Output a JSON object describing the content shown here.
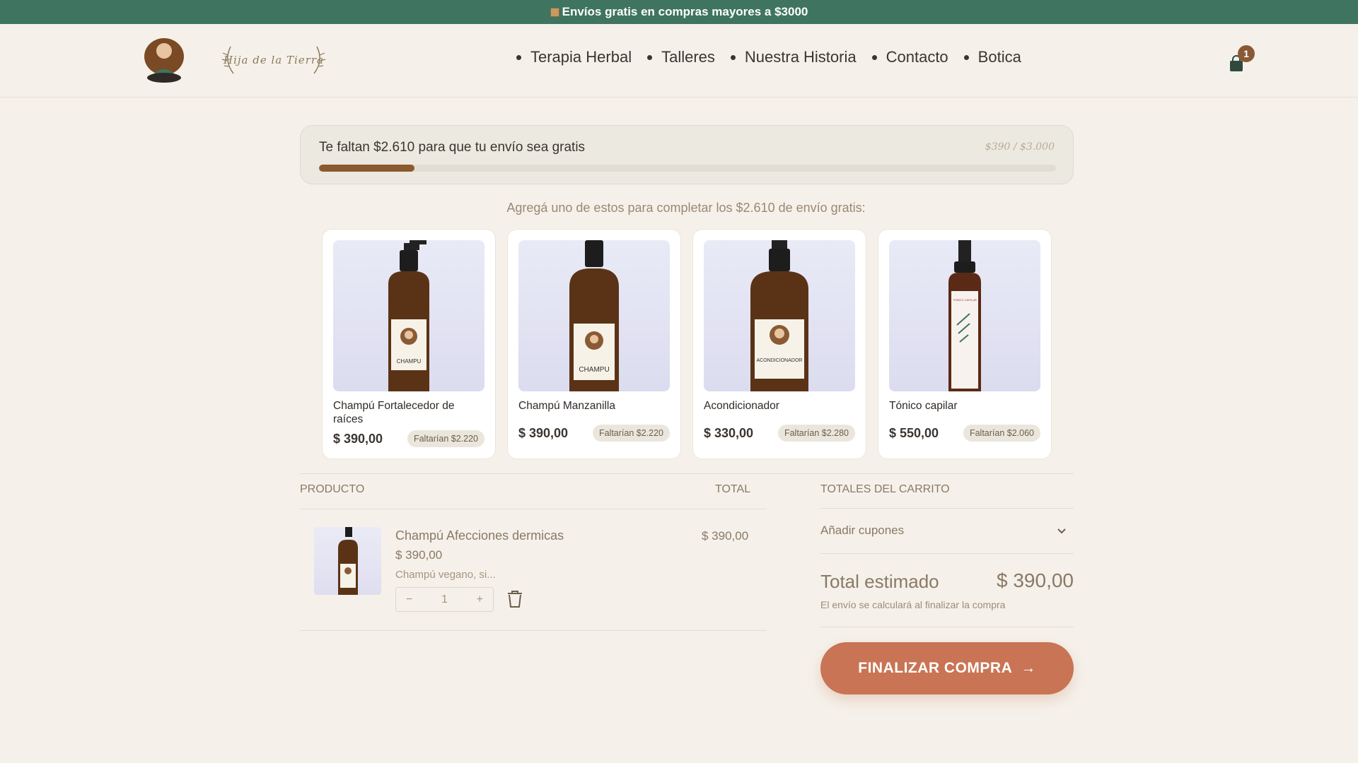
{
  "topbar": {
    "text": "Envíos gratis en compras mayores a $3000",
    "icon": "package-icon"
  },
  "header": {
    "logo_text": "Hija de la Tierra",
    "nav": [
      "Terapia Herbal",
      "Talleres",
      "Nuestra Historia",
      "Contacto",
      "Botica"
    ],
    "cart_count": "1"
  },
  "shipping_progress": {
    "message": "Te faltan $2.610 para que tu envío sea gratis",
    "ratio_label": "$390 / $3.000",
    "fraction": 0.13
  },
  "suggestions": {
    "title": "Agregá uno de estos para completar los $2.610 de envío gratis:",
    "items": [
      {
        "name": "Champú Fortalecedor de raíces",
        "price": "$ 390,00",
        "need": "Faltarían $2.220",
        "label": "CHAMPU"
      },
      {
        "name": "Champú Manzanilla",
        "price": "$ 390,00",
        "need": "Faltarían $2.220",
        "label": "CHAMPU"
      },
      {
        "name": "Acondicionador",
        "price": "$ 330,00",
        "need": "Faltarían $2.280",
        "label": "ACONDICIONADOR"
      },
      {
        "name": "Tónico capilar",
        "price": "$ 550,00",
        "need": "Faltarían $2.060",
        "label": "TÓNICO CAPILAR"
      }
    ]
  },
  "cart": {
    "col_product": "PRODUCTO",
    "col_total": "TOTAL",
    "item": {
      "name": "Champú Afecciones dermicas",
      "price": "$ 390,00",
      "desc": "Champú vegano, si...",
      "qty": "1",
      "minus": "−",
      "plus": "+",
      "total": "$ 390,00"
    }
  },
  "totals": {
    "heading": "TOTALES DEL CARRITO",
    "coupon_label": "Añadir cupones",
    "estimated_label": "Total estimado",
    "estimated_value": "$ 390,00",
    "note": "El envío se calculará al finalizar la compra",
    "checkout_label": "FINALIZAR COMPRA",
    "checkout_arrow": "→"
  },
  "colors": {
    "topbar": "#3f7460",
    "accent": "#c97454",
    "progress": "#8b5a2f",
    "badge": "#8a5a35"
  }
}
